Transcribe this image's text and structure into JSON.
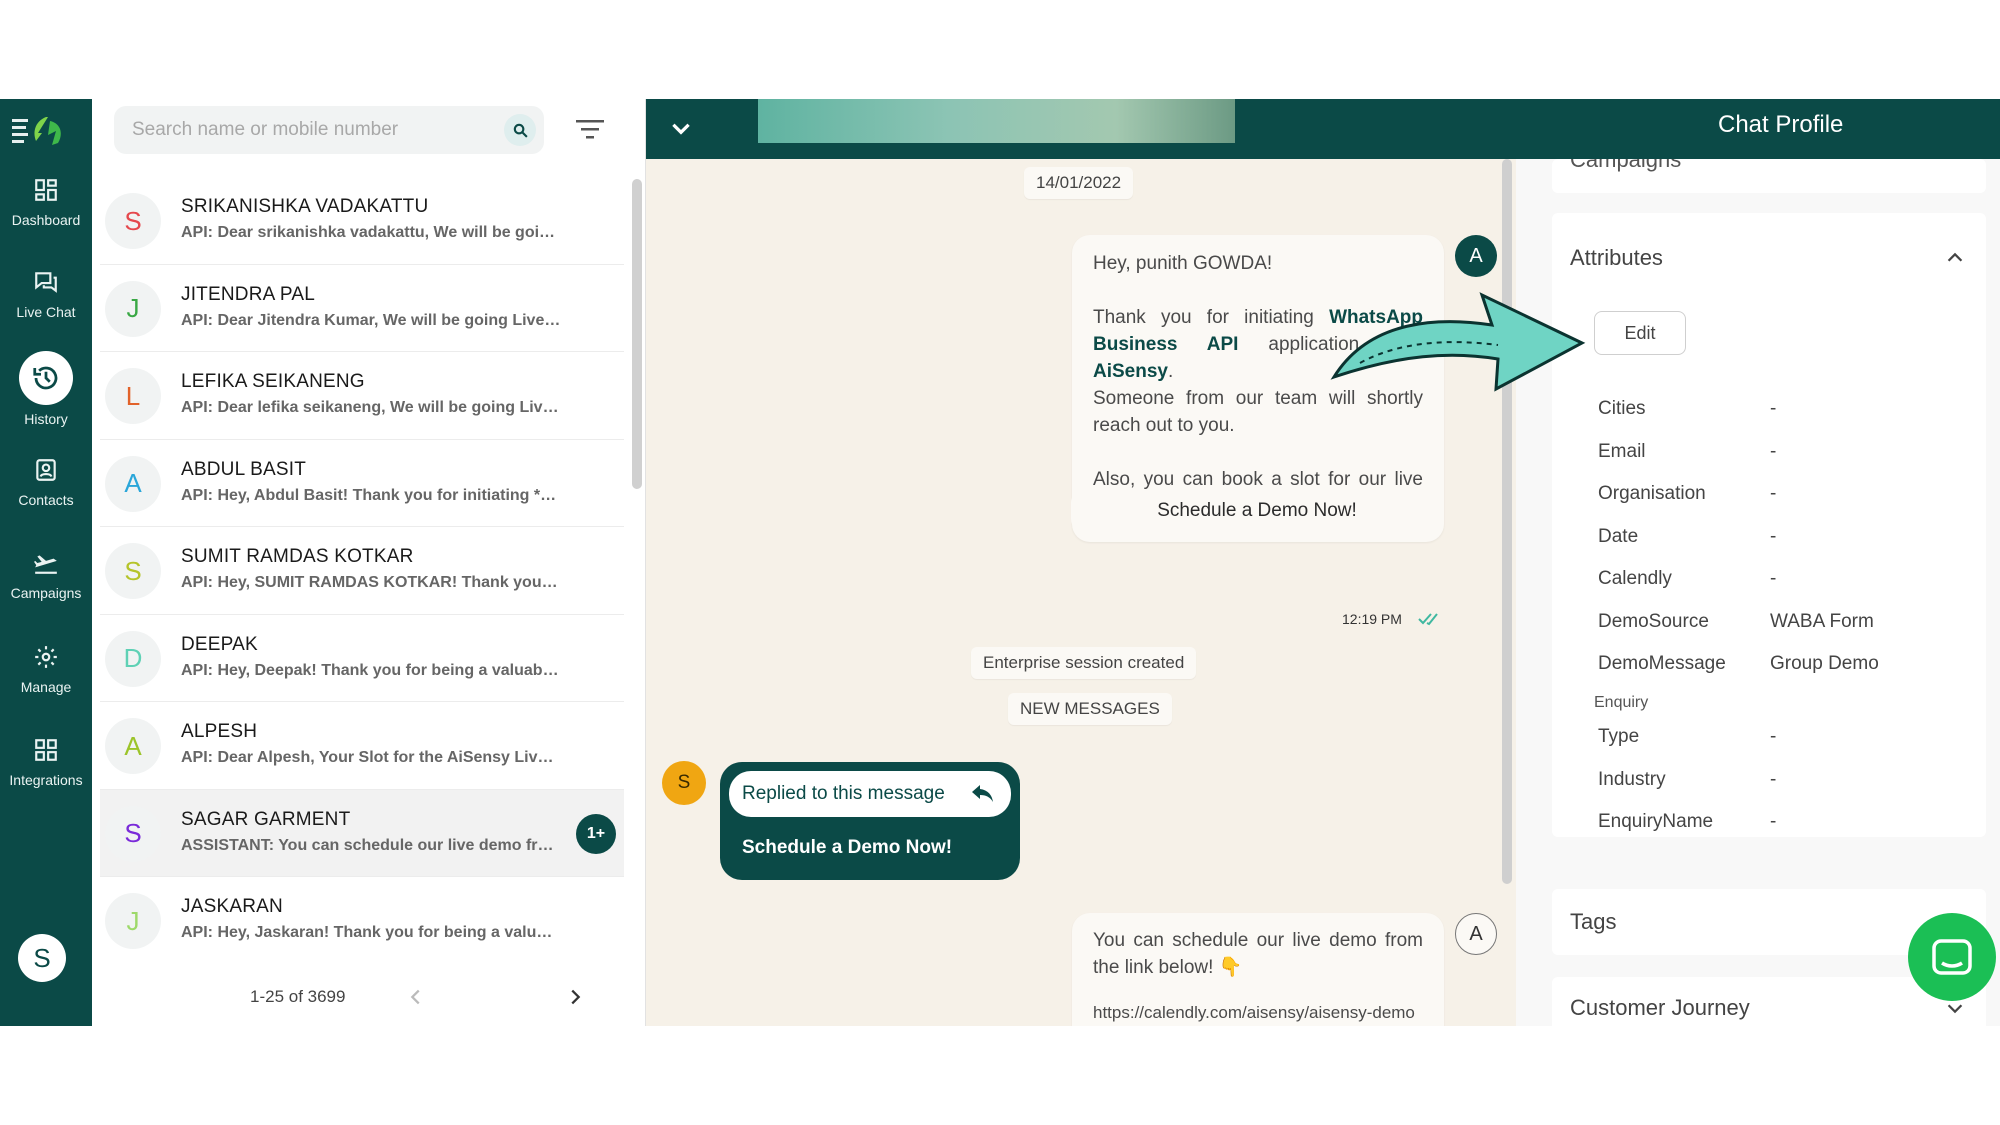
{
  "nav": {
    "items": [
      {
        "label": "Dashboard",
        "icon": "dashboard-icon"
      },
      {
        "label": "Live Chat",
        "icon": "chat-bubbles-icon"
      },
      {
        "label": "History",
        "icon": "history-icon"
      },
      {
        "label": "Contacts",
        "icon": "contacts-icon"
      },
      {
        "label": "Campaigns",
        "icon": "plane-icon"
      },
      {
        "label": "Manage",
        "icon": "gear-icon"
      },
      {
        "label": "Integrations",
        "icon": "integrations-icon"
      }
    ],
    "user_initial": "S",
    "accent": "#0b4a47"
  },
  "search": {
    "placeholder": "Search name or mobile number",
    "value": ""
  },
  "conversations": [
    {
      "initial": "S",
      "color": "#e5484d",
      "name": "SRIKANISHKA VADAKATTU",
      "preview": "API: Dear srikanishka vadakattu, We will be going Live demo"
    },
    {
      "initial": "J",
      "color": "#3aa845",
      "name": "JITENDRA PAL",
      "preview": "API: Dear Jitendra Kumar, We will be going Live demo"
    },
    {
      "initial": "L",
      "color": "#e2622a",
      "name": "LEFIKA SEIKANENG",
      "preview": "API: Dear lefika seikaneng, We will be going Live demo"
    },
    {
      "initial": "A",
      "color": "#2aa6d9",
      "name": "ABDUL BASIT",
      "preview": "API: Hey, Abdul Basit! Thank you for initiating *WhatsApp"
    },
    {
      "initial": "S",
      "color": "#b5c42a",
      "name": "SUMIT RAMDAS KOTKAR",
      "preview": "API: Hey, SUMIT RAMDAS KOTKAR! Thank you for initiating"
    },
    {
      "initial": "D",
      "color": "#5fd1b5",
      "name": "DEEPAK",
      "preview": "API: Hey, Deepak! Thank you for being a valuable customer"
    },
    {
      "initial": "A",
      "color": "#9cc42a",
      "name": "ALPESH",
      "preview": "API: Dear Alpesh, Your Slot for the AiSensy Live demo"
    },
    {
      "initial": "S",
      "color": "#7a2ad9",
      "name": "SAGAR GARMENT",
      "preview": "ASSISTANT: You can schedule our live demo from the link",
      "badge": "1+",
      "selected": true
    },
    {
      "initial": "J",
      "color": "#9ed96a",
      "name": "JASKARAN",
      "preview": "API: Hey, Jaskaran! Thank you for being a valuable customer"
    }
  ],
  "pager": {
    "text": "1-25 of 3699"
  },
  "chat": {
    "date": "14/01/2022",
    "greeting": "Hey, punith GOWDA!",
    "line1_pre": "Thank you for initiating ",
    "line1_bold": "WhatsApp Business API",
    "line1_mid": " application with ",
    "line1_bold2": "AiSensy",
    "line1_post": ".",
    "line2": "Someone from our team will shortly reach out to you.",
    "line3": "Also, you can book a slot for our live demo right away.",
    "cta": "Schedule a Demo Now!",
    "time": "12:19 PM",
    "agent_initial": "A",
    "system1": "Enterprise session created",
    "system2": "NEW MESSAGES",
    "reply_label": "Replied to this message",
    "reply_text": "Schedule a Demo Now!",
    "customer_initial": "S",
    "msg2": "You can schedule our live demo from the link below! 👇",
    "msg2_link": "https://calendly.com/aisensy/aisensy-demo"
  },
  "profile": {
    "title": "Chat Profile",
    "campaigns_label": "Campaigns",
    "attributes_label": "Attributes",
    "edit_label": "Edit",
    "attributes": [
      {
        "label": "Cities",
        "value": "-"
      },
      {
        "label": "Email",
        "value": "-"
      },
      {
        "label": "Organisation",
        "value": "-"
      },
      {
        "label": "Date",
        "value": "-"
      },
      {
        "label": "Calendly",
        "value": "-"
      },
      {
        "label": "DemoSource",
        "value": "WABA Form"
      },
      {
        "label": "DemoMessage",
        "value": "Group Demo"
      }
    ],
    "enquiry_label": "Enquiry",
    "enquiry": [
      {
        "label": "Type",
        "value": "-"
      },
      {
        "label": "Industry",
        "value": "-"
      },
      {
        "label": "EnquiryName",
        "value": "-"
      }
    ],
    "tags_label": "Tags",
    "journey_label": "Customer Journey"
  }
}
